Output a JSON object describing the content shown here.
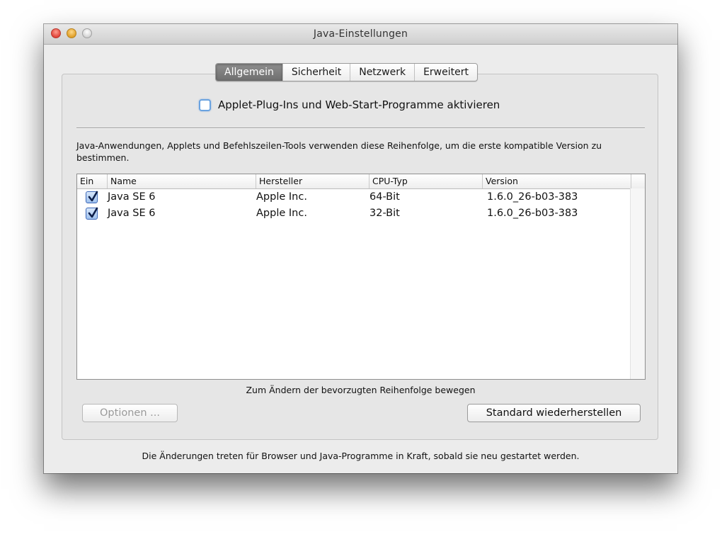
{
  "window": {
    "title": "Java-Einstellungen"
  },
  "tabs": [
    {
      "label": "Allgemein",
      "active": true
    },
    {
      "label": "Sicherheit",
      "active": false
    },
    {
      "label": "Netzwerk",
      "active": false
    },
    {
      "label": "Erweitert",
      "active": false
    }
  ],
  "plugin_checkbox": {
    "label": "Applet-Plug-Ins und Web-Start-Programme aktivieren",
    "checked": false
  },
  "description": "Java-Anwendungen, Applets und Befehlszeilen-Tools verwenden diese Reihenfolge, um die erste kompatible Version zu bestimmen.",
  "table": {
    "columns": [
      "Ein",
      "Name",
      "Hersteller",
      "CPU-Typ",
      "Version"
    ],
    "rows": [
      {
        "enabled": true,
        "name": "Java SE 6",
        "vendor": "Apple Inc.",
        "cpu": "64-Bit",
        "version": "1.6.0_26-b03-383"
      },
      {
        "enabled": true,
        "name": "Java SE 6",
        "vendor": "Apple Inc.",
        "cpu": "32-Bit",
        "version": "1.6.0_26-b03-383"
      }
    ]
  },
  "hint": "Zum Ändern der bevorzugten Reihenfolge bewegen",
  "buttons": {
    "options": "Optionen ...",
    "restore": "Standard wiederherstellen"
  },
  "footer": "Die Änderungen treten für Browser und Java-Programme in Kraft, sobald sie neu gestartet werden.",
  "colors": {
    "accent": "#3b67b8",
    "tab_active": "#7d7d7d"
  }
}
